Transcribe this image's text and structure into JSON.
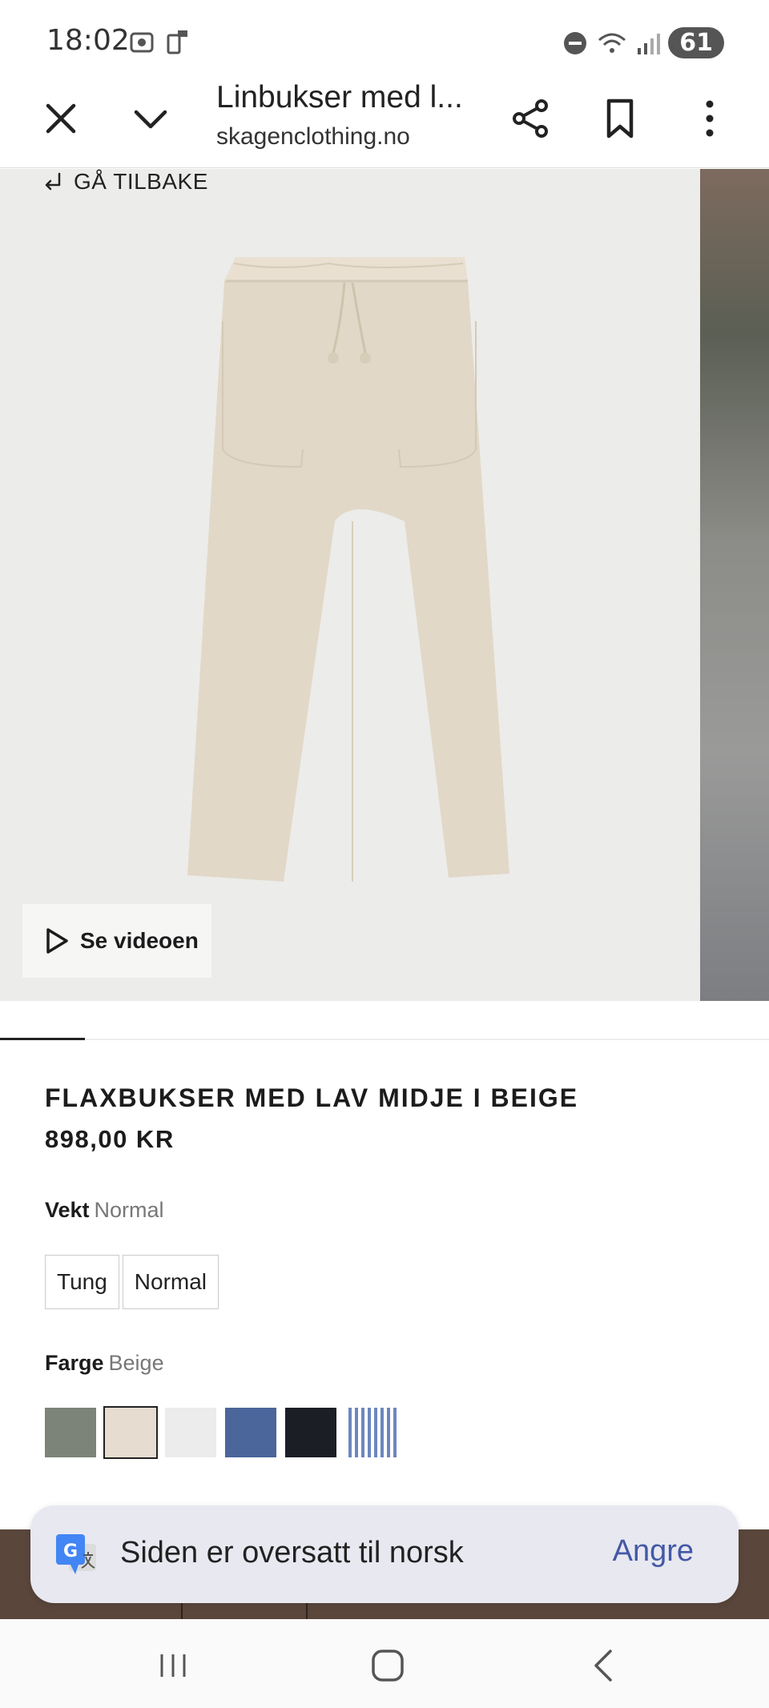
{
  "status_bar": {
    "time": "18:02",
    "battery": "61"
  },
  "toolbar": {
    "title": "Linbukser med l...",
    "url": "skagenclothing.no"
  },
  "gallery": {
    "back_label": "GÅ TILBAKE",
    "video_label": "Se videoen"
  },
  "product": {
    "title": "FLAXBUKSER MED LAV MIDJE I BEIGE",
    "price": "898,00 KR",
    "weight": {
      "label": "Vekt",
      "value": "Normal",
      "options": [
        "Tung",
        "Normal"
      ]
    },
    "color": {
      "label": "Farge",
      "value": "Beige",
      "swatches": [
        "#7c8379",
        "#e6ddd0",
        "#ececec",
        "#4a669a",
        "#1b1e24",
        "striped-blue"
      ]
    }
  },
  "translate_bar": {
    "message": "Siden er oversatt til norsk",
    "undo_label": "Angre"
  },
  "colors": {
    "accent": "#4359a6",
    "footer_brown": "#5a463b",
    "pants": "#e2d8c8"
  }
}
